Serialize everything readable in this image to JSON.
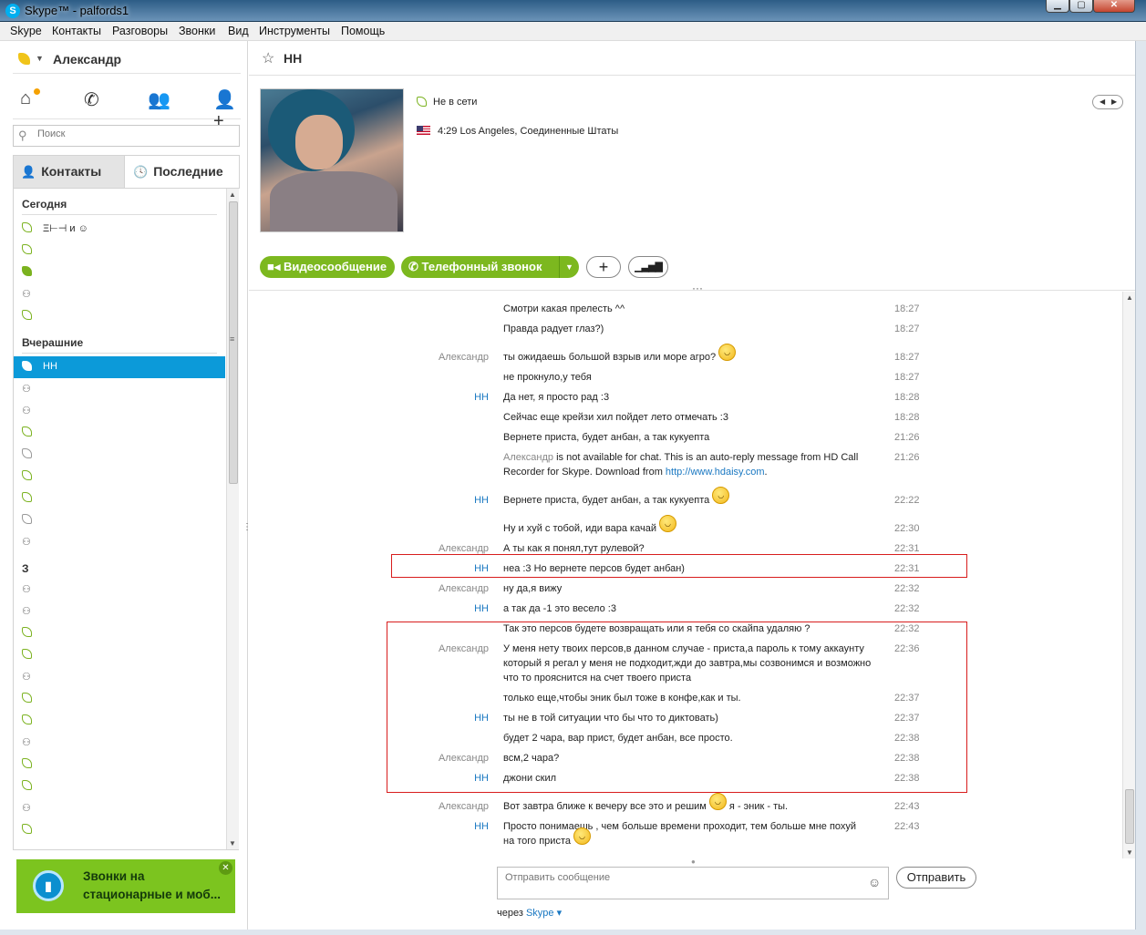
{
  "window": {
    "title": "Skype™ - palfords1",
    "app_icon": "S",
    "min": "▁",
    "max": "▢",
    "close": "✕"
  },
  "menu": [
    "Skype",
    "Контакты",
    "Разговоры",
    "Звонки",
    "Вид",
    "Инструменты",
    "Помощь"
  ],
  "profile": {
    "name": "Александр",
    "status_color": "#f0c419"
  },
  "nav_icons": [
    "home-icon",
    "phone-icon",
    "group-icon",
    "add-contact-icon"
  ],
  "search": {
    "placeholder": "Поиск"
  },
  "tabs": {
    "contacts": "Контакты",
    "recent": "Последние"
  },
  "sections": {
    "today": "Сегодня",
    "yesterday": "Вчерашние",
    "older": "З"
  },
  "today_rows": [
    {
      "label": "Ξ⊢⊣ и ☺",
      "icon": "leaf"
    },
    {
      "label": "",
      "icon": "leaf"
    },
    {
      "label": "",
      "icon": "leaf-check"
    },
    {
      "label": "",
      "icon": "group"
    },
    {
      "label": "",
      "icon": "leaf"
    }
  ],
  "yesterday_rows": [
    {
      "label": "НН",
      "icon": "leaf",
      "selected": true
    },
    {
      "label": "",
      "icon": "group"
    },
    {
      "label": "",
      "icon": "group"
    },
    {
      "label": "",
      "icon": "leaf"
    },
    {
      "label": "",
      "icon": "leaf-grey"
    },
    {
      "label": "",
      "icon": "leaf"
    },
    {
      "label": "",
      "icon": "leaf"
    },
    {
      "label": "",
      "icon": "leaf-grey"
    },
    {
      "label": "",
      "icon": "group"
    }
  ],
  "older_rows": [
    "group",
    "group",
    "leaf",
    "leaf",
    "group",
    "leaf",
    "leaf",
    "group",
    "leaf",
    "leaf",
    "group",
    "leaf"
  ],
  "promo": {
    "text": "Звонки на стационарные и моб...",
    "badge": "▮",
    "close": "✕"
  },
  "contact": {
    "name": "НН",
    "presence": "Не в сети",
    "location": "4:29 Los Angeles, Соединенные Штаты"
  },
  "actions": {
    "video": "Видеосообщение",
    "call": "Телефонный звонок",
    "add": "+",
    "signal": "▁▃▅▇"
  },
  "messages": [
    {
      "author": "",
      "text": "Смотри какая прелесть ^^",
      "time": "18:27"
    },
    {
      "author": "",
      "text": "Правда радует глаз?)",
      "time": "18:27"
    },
    {
      "author": "Александр",
      "text": "ты ожидаешь большой взрыв или море агро?",
      "time": "18:27",
      "smile": true
    },
    {
      "author": "",
      "text": "не прокнуло,у тебя",
      "time": "18:27"
    },
    {
      "author": "НН",
      "text": "Да нет, я просто рад :3",
      "time": "18:28"
    },
    {
      "author": "",
      "text": "Сейчас еще крейзи хил пойдет лето отмечать :3",
      "time": "18:28"
    },
    {
      "author": "",
      "text": "Вернете приста, будет анбан, а так кукуепта",
      "time": "21:26"
    },
    {
      "author": "",
      "auto_name": "Александр",
      "auto_text": " is not available for chat. This is an auto-reply message from HD Call Recorder for Skype. Download from ",
      "auto_link": "http://www.hdaisy.com",
      "auto_end": ".",
      "time": "21:26"
    },
    {
      "author": "НН",
      "text": "Вернете приста, будет анбан, а так кукуепта",
      "time": "22:22",
      "smile": true
    },
    {
      "author": "",
      "text": "Ну и хуй с тобой, иди вара качай",
      "time": "22:30",
      "smile": true
    },
    {
      "author": "Александр",
      "text": "А ты как я понял,тут рулевой?",
      "time": "22:31"
    },
    {
      "author": "НН",
      "text": "неа :3 Но вернете персов будет анбан)",
      "time": "22:31"
    },
    {
      "author": "Александр",
      "text": "ну да,я вижу",
      "time": "22:32"
    },
    {
      "author": "НН",
      "text": "а так да -1 это весело :3",
      "time": "22:32"
    },
    {
      "author": "",
      "text": "Так это персов будете возвращать или я тебя со скайпа удаляю ?",
      "time": "22:32"
    },
    {
      "author": "Александр",
      "text": "У меня нету твоих персов,в данном случае - приста,а пароль к тому аккаунту который я регал у меня не подходит,жди до завтра,мы созвонимся и возможно что то прояснится на счет твоего приста",
      "time": "22:36"
    },
    {
      "author": "",
      "text": "только еще,чтобы эник был тоже в конфе,как и ты.",
      "time": "22:37"
    },
    {
      "author": "НН",
      "text": "ты не в той ситуации что бы что то диктовать)",
      "time": "22:37"
    },
    {
      "author": "",
      "text": "будет 2 чара, вар прист, будет анбан, все просто.",
      "time": "22:38"
    },
    {
      "author": "Александр",
      "text": "всм,2 чара?",
      "time": "22:38"
    },
    {
      "author": "НН",
      "text": "джони скил",
      "time": "22:38"
    },
    {
      "author": "Александр",
      "text": "Вот завтра ближе к вечеру все это и решим",
      "text2": " я - эник  - ты.",
      "time": "22:43",
      "smile": true
    },
    {
      "author": "НН",
      "text": "Просто понимаешь , чем больше времени проходит, тем больше мне похуй на того приста",
      "time": "22:43",
      "smile": true
    }
  ],
  "composer": {
    "placeholder": "Отправить сообщение",
    "send": "Отправить",
    "via_prefix": "через",
    "via_link": "Skype ▾"
  },
  "colors": {
    "accent_green": "#7cb81f",
    "selected_blue": "#0c9ad9",
    "highlight_red": "#d81d1d",
    "link_blue": "#1a78c2"
  }
}
